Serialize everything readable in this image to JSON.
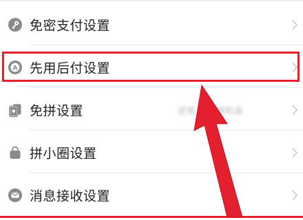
{
  "settings": {
    "items": [
      {
        "label": "免密支付设置",
        "icon": "key-icon"
      },
      {
        "label": "先用后付设置",
        "icon": "pay-later-icon"
      },
      {
        "label": "免拼设置",
        "icon": "cards-icon",
        "sub": "还有 次免拼机会"
      },
      {
        "label": "拼小圈设置",
        "icon": "bag-icon"
      },
      {
        "label": "消息接收设置",
        "icon": "mail-icon"
      }
    ]
  },
  "colors": {
    "highlight": "#e5202e",
    "icon": "#8a8a8a",
    "text": "#222222",
    "chevron": "#c8c8c8"
  }
}
